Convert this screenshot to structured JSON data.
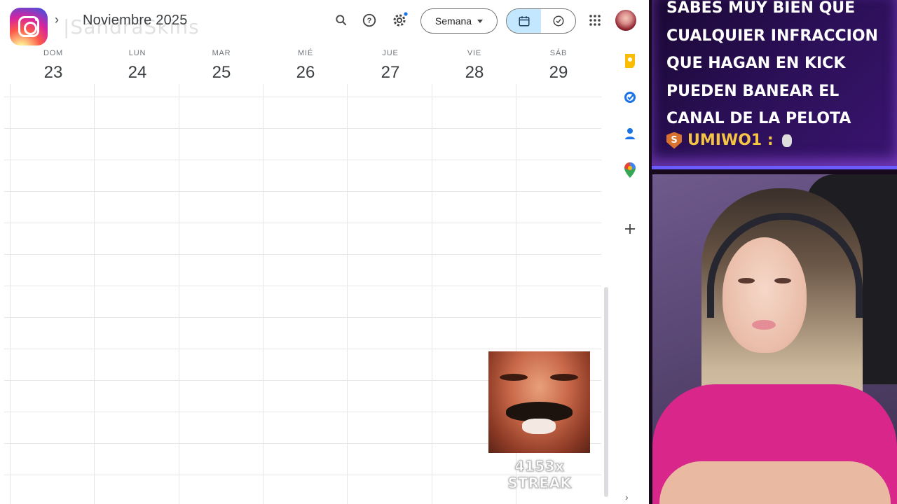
{
  "calendar": {
    "month_title": "Noviembre 2025",
    "view_select": "Semana",
    "days": [
      {
        "dow": "DOM",
        "num": "23"
      },
      {
        "dow": "LUN",
        "num": "24"
      },
      {
        "dow": "MAR",
        "num": "25"
      },
      {
        "dow": "MIÉ",
        "num": "26"
      },
      {
        "dow": "JUE",
        "num": "27"
      },
      {
        "dow": "VIE",
        "num": "28"
      },
      {
        "dow": "SÁB",
        "num": "29"
      }
    ],
    "toolbar_icons": [
      "search-icon",
      "help-icon",
      "settings-icon",
      "apps-icon"
    ],
    "side_icons": [
      "keep-icon",
      "tasks-icon",
      "contacts-icon",
      "maps-icon",
      "add-icon"
    ]
  },
  "overlay": {
    "instagram_handle": "|SandraSkins",
    "streak_text": "4153x STREAK"
  },
  "chat": {
    "message": "SABES MUY BIEN QUE CUALQUIER INFRACCION QUE HAGAN EN KICK PUEDEN BANEAR EL CANAL DE LA PELOTA",
    "username": "UMIWO1 :",
    "badge": "S"
  },
  "colors": {
    "accent_toggle": "#c2e7ff",
    "chat_bg": "#2a0f55",
    "username": "#f6c445",
    "settings_dot": "#1a73e8"
  }
}
